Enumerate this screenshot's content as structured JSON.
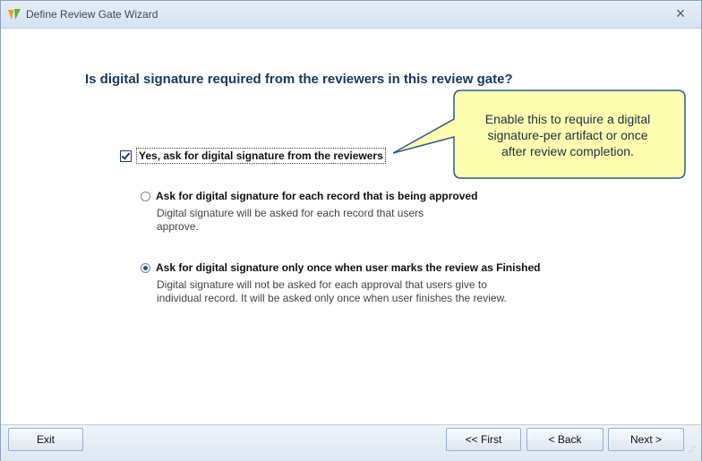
{
  "window": {
    "title": "Define Review Gate Wizard",
    "close_icon": "close-icon",
    "app_icon": "app-logo-icon"
  },
  "question": "Is digital signature required from the reviewers in this review gate?",
  "callout": {
    "line1": "Enable this to require a digital",
    "line2": "signature-per artifact or once",
    "line3": "after review completion."
  },
  "checkbox": {
    "label": "Yes, ask for digital signature from the reviewers",
    "checked": true
  },
  "options": [
    {
      "label": "Ask for digital signature for each record that is being approved",
      "desc1": "Digital signature will be asked for each record that users",
      "desc2": "approve.",
      "selected": false
    },
    {
      "label": "Ask for digital signature only once when user marks the review as Finished",
      "desc1": "Digital signature will not be asked for each approval that users give to",
      "desc2": "individual record. It will be asked only once when user finishes the review.",
      "selected": true
    }
  ],
  "buttons": {
    "exit": "Exit",
    "first": "<< First",
    "back": "< Back",
    "next": "Next >"
  },
  "colors": {
    "question": "#17375e",
    "callout_fill": "#fefeb0",
    "callout_border": "#2e5a8b"
  }
}
